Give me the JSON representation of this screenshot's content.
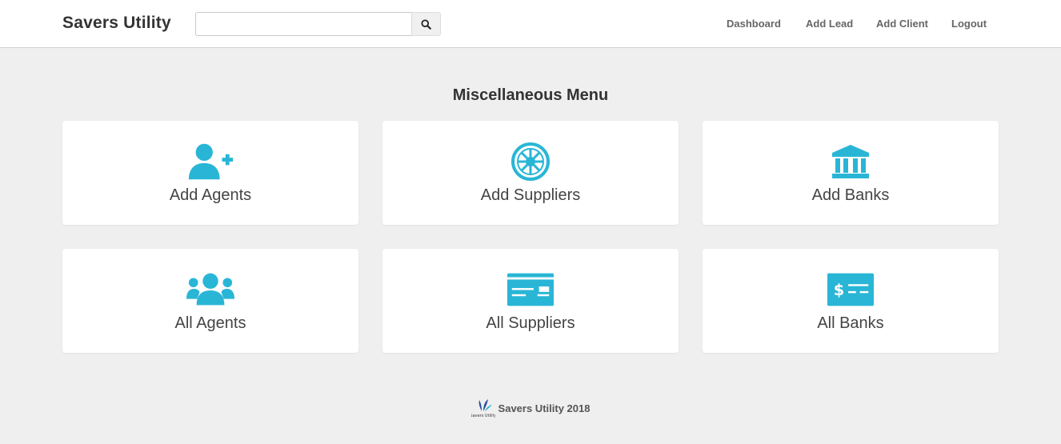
{
  "app": {
    "brand": "Savers Utility"
  },
  "search": {
    "placeholder": "",
    "value": ""
  },
  "nav": {
    "items": [
      {
        "label": "Dashboard"
      },
      {
        "label": "Add Lead"
      },
      {
        "label": "Add Client"
      },
      {
        "label": "Logout"
      }
    ]
  },
  "main": {
    "title": "Miscellaneous Menu",
    "cards": [
      {
        "label": "Add Agents",
        "icon": "user-plus-icon"
      },
      {
        "label": "Add Suppliers",
        "icon": "empire-emblem-icon"
      },
      {
        "label": "Add Banks",
        "icon": "bank-icon"
      },
      {
        "label": "All Agents",
        "icon": "users-group-icon"
      },
      {
        "label": "All Suppliers",
        "icon": "credit-card-icon"
      },
      {
        "label": "All Banks",
        "icon": "money-check-icon"
      }
    ]
  },
  "footer": {
    "logo_text": "Savers Utility",
    "text": "Savers Utility 2018"
  },
  "colors": {
    "accent": "#29b6d6",
    "background": "#efefef",
    "card": "#ffffff",
    "navbar": "#ffffff"
  }
}
